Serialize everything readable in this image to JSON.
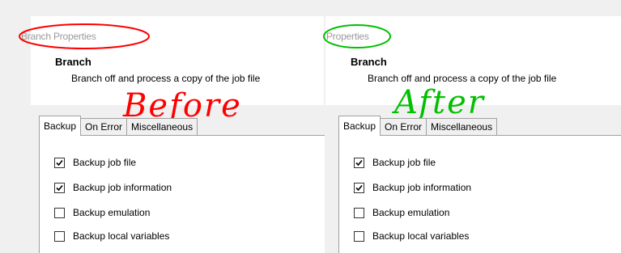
{
  "before": {
    "group_title": "Branch Properties",
    "item_title": "Branch",
    "item_desc": "Branch off and process a copy of the job file",
    "annotation": "Before",
    "annotation_color": "#ff0000",
    "tabs": [
      "Backup",
      "On Error",
      "Miscellaneous"
    ],
    "active_tab": "Backup",
    "options": [
      {
        "label": "Backup job file",
        "checked": true
      },
      {
        "label": "Backup job information",
        "checked": true
      },
      {
        "label": "Backup emulation",
        "checked": false
      },
      {
        "label": "Backup local variables",
        "checked": false
      }
    ]
  },
  "after": {
    "group_title": "Properties",
    "item_title": "Branch",
    "item_desc": "Branch off and process a copy of the job file",
    "annotation": "After",
    "annotation_color": "#00c000",
    "tabs": [
      "Backup",
      "On Error",
      "Miscellaneous"
    ],
    "active_tab": "Backup",
    "options": [
      {
        "label": "Backup job file",
        "checked": true
      },
      {
        "label": "Backup job information",
        "checked": true
      },
      {
        "label": "Backup emulation",
        "checked": false
      },
      {
        "label": "Backup local variables",
        "checked": false
      }
    ]
  }
}
